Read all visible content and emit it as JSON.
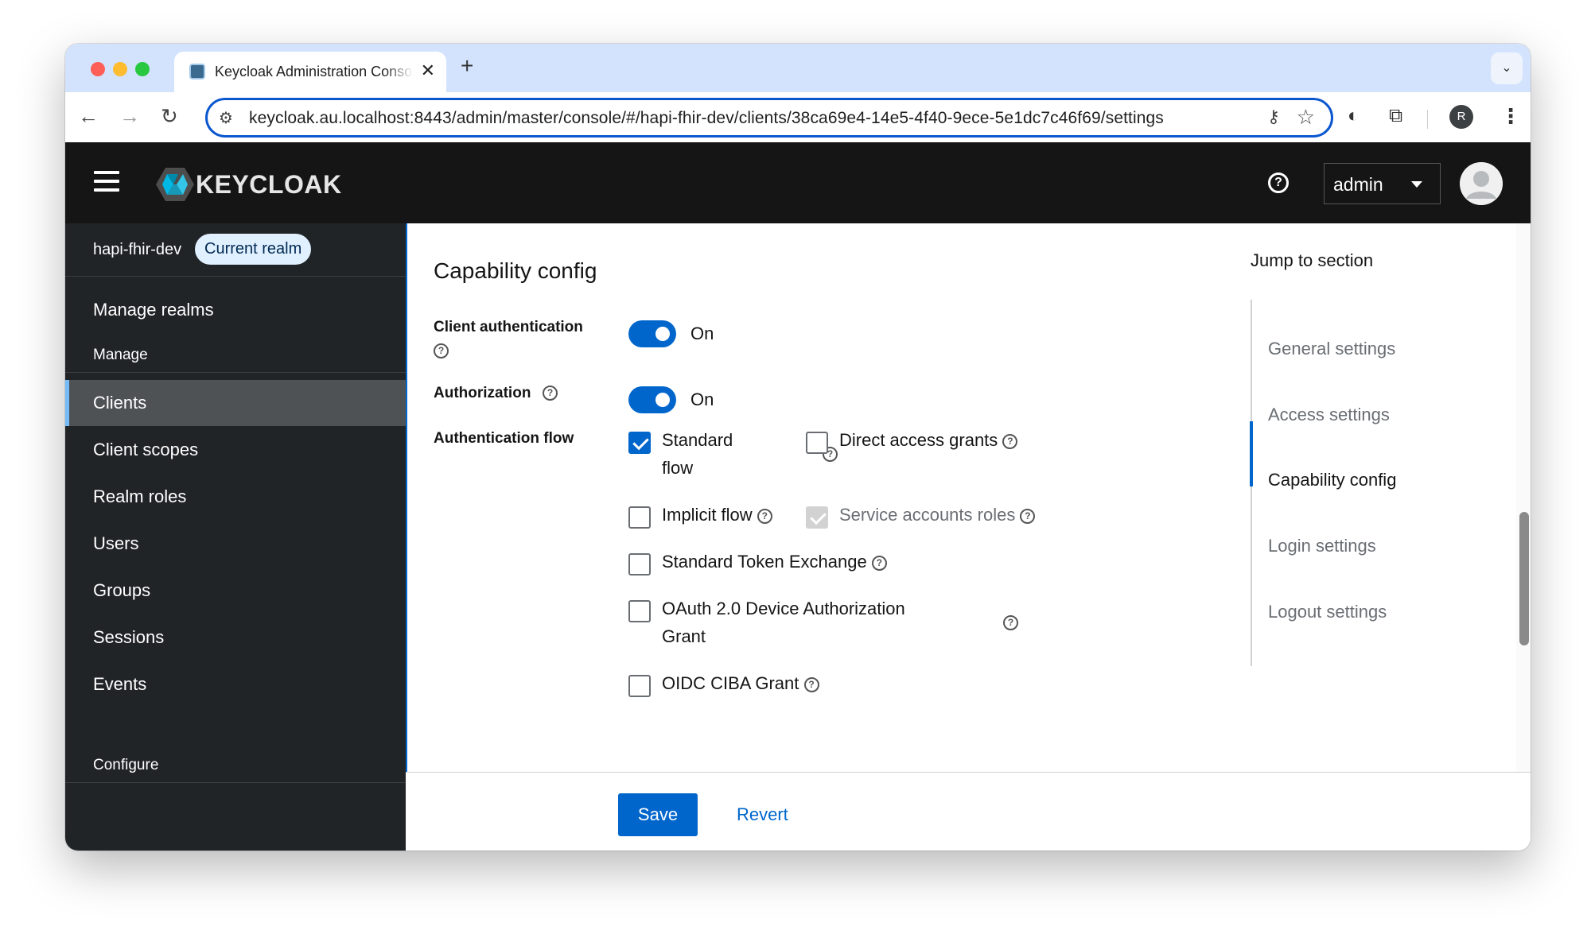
{
  "browser": {
    "tab_title": "Keycloak Administration Console",
    "url": "keycloak.au.localhost:8443/admin/master/console/#/hapi-fhir-dev/clients/38ca69e4-14e5-4f40-9ece-5e1dc7c46f69/settings",
    "profile_initial": "R"
  },
  "header": {
    "logo_text": "KEYCLOAK",
    "user_name": "admin"
  },
  "sidebar": {
    "realm_name": "hapi-fhir-dev",
    "realm_badge": "Current realm",
    "manage_realms": "Manage realms",
    "section_manage": "Manage",
    "items": [
      {
        "label": "Clients",
        "active": true
      },
      {
        "label": "Client scopes"
      },
      {
        "label": "Realm roles"
      },
      {
        "label": "Users"
      },
      {
        "label": "Groups"
      },
      {
        "label": "Sessions"
      },
      {
        "label": "Events"
      }
    ],
    "section_configure": "Configure"
  },
  "main": {
    "section_title": "Capability config",
    "client_auth": {
      "label": "Client authentication",
      "state": "On"
    },
    "authorization": {
      "label": "Authorization",
      "state": "On"
    },
    "auth_flow": {
      "label": "Authentication flow",
      "standard_flow_line1": "Standard",
      "standard_flow_line2": "flow",
      "direct_access": "Direct access grants",
      "implicit_flow": "Implicit flow",
      "service_accounts": "Service accounts roles",
      "token_exchange": "Standard Token Exchange",
      "device_grant_line1": "OAuth 2.0 Device Authorization",
      "device_grant_line2": "Grant",
      "ciba": "OIDC CIBA Grant"
    },
    "jump": {
      "title": "Jump to section",
      "items": [
        "General settings",
        "Access settings",
        "Capability config",
        "Login settings",
        "Logout settings"
      ],
      "active_index": 2
    },
    "footer": {
      "save": "Save",
      "revert": "Revert"
    }
  },
  "colors": {
    "accent": "#0066cc",
    "header_bg": "#151515",
    "sidebar_bg": "#212427"
  }
}
